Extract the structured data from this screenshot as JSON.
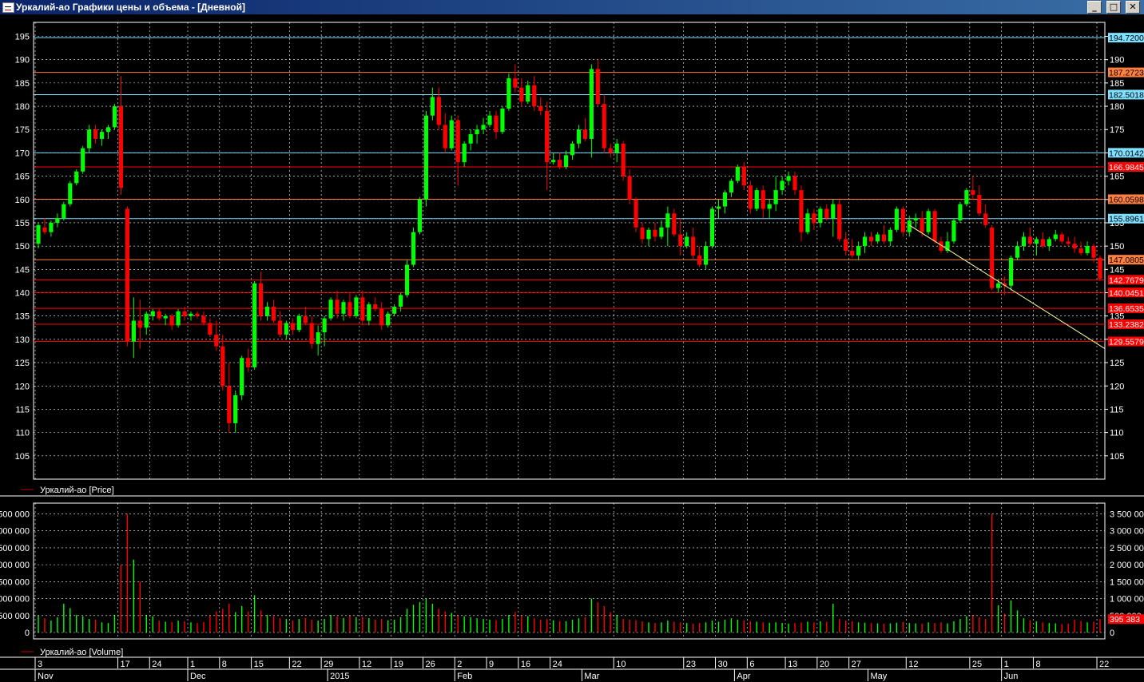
{
  "window": {
    "title": "Уркалий-ао Графики цены и объема - [Дневной]",
    "buttons": {
      "minimize": "_",
      "maximize": "□",
      "close": "✕"
    }
  },
  "colors": {
    "up": "#00ff00",
    "down": "#ff0000",
    "grid": "#ffffff",
    "axis_text": "#ffffff",
    "trendline": "#ffff99"
  },
  "legend": {
    "price": "Уркалий-ао [Price]",
    "volume": "Уркалий-ао [Volume]"
  },
  "chart_data": {
    "type": "candlestick",
    "price_axis": {
      "min": 100,
      "max": 198,
      "ticks": [
        105,
        110,
        115,
        120,
        125,
        130,
        135,
        140,
        145,
        150,
        155,
        160,
        165,
        170,
        175,
        180,
        185,
        190,
        195
      ]
    },
    "volume_axis": {
      "min": 0,
      "max": 3700000,
      "ticks": [
        0,
        500000,
        1000000,
        1500000,
        2000000,
        2500000,
        3000000,
        3500000
      ],
      "left_labels": [
        "0",
        "500 000",
        "000 000",
        "500 000",
        "000 000",
        "500 000",
        "000 000",
        "500 000"
      ],
      "right_labels": [
        "0",
        "500 000",
        "1 000 000",
        "1 500 000",
        "2 000 000",
        "2 500 000",
        "3 000 000",
        "3 500 000"
      ]
    },
    "levels": [
      {
        "value": 194.72,
        "label": "194.7200",
        "color": "#7fe0ff",
        "text": "#000000"
      },
      {
        "value": 187.272,
        "label": "187.2723",
        "color": "#ff8040",
        "text": "#000000"
      },
      {
        "value": 182.5018,
        "label": "182.5018",
        "color": "#7fe0ff",
        "text": "#000000"
      },
      {
        "value": 170.0142,
        "label": "170.0142",
        "color": "#7fe0ff",
        "text": "#000000"
      },
      {
        "value": 166.984,
        "label": "166.9845",
        "color": "#ff0000",
        "text": "#ffffff"
      },
      {
        "value": 160.059,
        "label": "160.0598",
        "color": "#ff8040",
        "text": "#000000"
      },
      {
        "value": 155.896,
        "label": "155.8961",
        "color": "#7fe0ff",
        "text": "#000000"
      },
      {
        "value": 147.08,
        "label": "147.0805",
        "color": "#ff8040",
        "text": "#000000"
      },
      {
        "value": 142.767,
        "label": "142.7679",
        "color": "#ff0000",
        "text": "#ffffff"
      },
      {
        "value": 140.045,
        "label": "140.0451",
        "color": "#ff0000",
        "text": "#ffffff"
      },
      {
        "value": 136.653,
        "label": "136.6535",
        "color": "#ff0000",
        "text": "#ffffff"
      },
      {
        "value": 133.238,
        "label": "133.2382",
        "color": "#ff0000",
        "text": "#ffffff"
      },
      {
        "value": 129.557,
        "label": "129.5579",
        "color": "#ff0000",
        "text": "#ffffff"
      }
    ],
    "last_volume_label": "395 383",
    "last_volume": 395383,
    "trendline": {
      "from": {
        "bar": 137,
        "price": 154.5
      },
      "to": {
        "bar": 194,
        "price": 128
      }
    },
    "day_labels": [
      {
        "bar": 0,
        "label": "3"
      },
      {
        "bar": 13,
        "label": "17"
      },
      {
        "bar": 18,
        "label": "24"
      },
      {
        "bar": 24,
        "label": "1"
      },
      {
        "bar": 29,
        "label": "8"
      },
      {
        "bar": 34,
        "label": "15"
      },
      {
        "bar": 40,
        "label": "22"
      },
      {
        "bar": 45,
        "label": "29"
      },
      {
        "bar": 51,
        "label": "12"
      },
      {
        "bar": 56,
        "label": "19"
      },
      {
        "bar": 61,
        "label": "26"
      },
      {
        "bar": 66,
        "label": "2"
      },
      {
        "bar": 71,
        "label": "9"
      },
      {
        "bar": 76,
        "label": "16"
      },
      {
        "bar": 81,
        "label": "24"
      },
      {
        "bar": 91,
        "label": "10"
      },
      {
        "bar": 102,
        "label": "23"
      },
      {
        "bar": 107,
        "label": "30"
      },
      {
        "bar": 112,
        "label": "6"
      },
      {
        "bar": 118,
        "label": "13"
      },
      {
        "bar": 123,
        "label": "20"
      },
      {
        "bar": 128,
        "label": "27"
      },
      {
        "bar": 137,
        "label": "12"
      },
      {
        "bar": 147,
        "label": "25"
      },
      {
        "bar": 152,
        "label": "1"
      },
      {
        "bar": 157,
        "label": "8"
      },
      {
        "bar": 167,
        "label": "22"
      }
    ],
    "month_labels": [
      {
        "bar": 0,
        "label": "Nov"
      },
      {
        "bar": 24,
        "label": "Dec"
      },
      {
        "bar": 46,
        "label": "2015"
      },
      {
        "bar": 66,
        "label": "Feb"
      },
      {
        "bar": 86,
        "label": "Mar"
      },
      {
        "bar": 110,
        "label": "Apr"
      },
      {
        "bar": 131,
        "label": "May"
      },
      {
        "bar": 152,
        "label": "Jun"
      }
    ],
    "candles": [
      [
        150.5,
        155,
        149.5,
        154.5,
        500000
      ],
      [
        154,
        156,
        152.5,
        153,
        420000
      ],
      [
        153,
        155.5,
        152,
        155,
        350000
      ],
      [
        155,
        157,
        154,
        156,
        450000
      ],
      [
        156,
        159.5,
        155.5,
        159,
        850000
      ],
      [
        159,
        164,
        158.5,
        163.5,
        720000
      ],
      [
        163.5,
        166.5,
        163,
        166,
        520000
      ],
      [
        166,
        171.5,
        165.5,
        171,
        480000
      ],
      [
        171,
        176,
        170,
        175,
        400000
      ],
      [
        175,
        176,
        172,
        173,
        380000
      ],
      [
        173,
        175,
        171.5,
        174.5,
        300000
      ],
      [
        174.5,
        176,
        173,
        175.5,
        280000
      ],
      [
        175.5,
        180.5,
        175,
        180,
        520000
      ],
      [
        180,
        186.5,
        161,
        162.5,
        2000000
      ],
      [
        158,
        158.5,
        128.5,
        129.5,
        3500000
      ],
      [
        129.5,
        139,
        126,
        134,
        2150000
      ],
      [
        134,
        138.5,
        128,
        132.5,
        1500000
      ],
      [
        132.5,
        136,
        131,
        135.5,
        520000
      ],
      [
        135,
        136.5,
        134,
        136,
        480000
      ],
      [
        136,
        136.5,
        134,
        134.5,
        350000
      ],
      [
        134.5,
        135.5,
        133,
        135,
        320000
      ],
      [
        135,
        135.5,
        132,
        133,
        310000
      ],
      [
        133,
        136.5,
        132.5,
        136,
        350000
      ],
      [
        136,
        137,
        134,
        135,
        330000
      ],
      [
        135,
        136,
        134,
        135.5,
        300000
      ],
      [
        135.5,
        136,
        134.5,
        135,
        280000
      ],
      [
        135,
        136,
        133,
        133.5,
        310000
      ],
      [
        133.5,
        134.5,
        130.5,
        131,
        500000
      ],
      [
        131,
        134,
        127.5,
        128.5,
        620000
      ],
      [
        128.5,
        131,
        119,
        120,
        700000
      ],
      [
        120,
        125,
        110,
        112,
        850000
      ],
      [
        112,
        119,
        110,
        118,
        600000
      ],
      [
        118,
        126.5,
        117,
        126,
        780000
      ],
      [
        126,
        128,
        123,
        124,
        620000
      ],
      [
        124,
        142.5,
        123.5,
        142,
        1100000
      ],
      [
        142,
        144.5,
        134,
        135,
        650000
      ],
      [
        135,
        138,
        134,
        137,
        520000
      ],
      [
        137,
        138.5,
        133.5,
        134,
        480000
      ],
      [
        134,
        136,
        130.5,
        131,
        420000
      ],
      [
        131,
        134,
        130,
        133.5,
        400000
      ],
      [
        133.5,
        134.5,
        131,
        132,
        350000
      ],
      [
        132,
        135.5,
        131.5,
        135,
        400000
      ],
      [
        135,
        137,
        133,
        133.5,
        430000
      ],
      [
        133.5,
        135,
        128,
        129,
        380000
      ],
      [
        129,
        133,
        126.5,
        131.5,
        350000
      ],
      [
        131.5,
        135,
        128.5,
        134.5,
        400000
      ],
      [
        134.5,
        139,
        134,
        138.5,
        520000
      ],
      [
        138.5,
        140.5,
        134.5,
        135.5,
        480000
      ],
      [
        135.5,
        138.5,
        134,
        138,
        430000
      ],
      [
        138,
        140,
        134.5,
        135,
        500000
      ],
      [
        135,
        139.5,
        134.5,
        139,
        450000
      ],
      [
        139,
        140.5,
        133,
        134,
        460000
      ],
      [
        134,
        138,
        133,
        137.5,
        420000
      ],
      [
        137.5,
        139,
        136,
        136.5,
        380000
      ],
      [
        136.5,
        138,
        132,
        133,
        400000
      ],
      [
        133,
        136,
        132.5,
        135.5,
        360000
      ],
      [
        135.5,
        137.5,
        135,
        137,
        380000
      ],
      [
        137,
        140,
        136,
        139.5,
        450000
      ],
      [
        139.5,
        147,
        139,
        146,
        700000
      ],
      [
        146,
        154,
        145.5,
        153,
        820000
      ],
      [
        153,
        160.5,
        152.5,
        160,
        900000
      ],
      [
        160,
        179,
        158.5,
        178,
        1000000
      ],
      [
        178,
        184,
        177,
        182,
        850000
      ],
      [
        182,
        184,
        175,
        176,
        700000
      ],
      [
        176,
        178.5,
        170,
        171,
        620000
      ],
      [
        171,
        178,
        170.5,
        177,
        580000
      ],
      [
        177,
        178,
        163,
        168,
        520000
      ],
      [
        168,
        172.5,
        167,
        172,
        480000
      ],
      [
        172,
        175,
        170.5,
        174,
        450000
      ],
      [
        174,
        176,
        172,
        175,
        420000
      ],
      [
        175,
        177.5,
        174,
        176,
        400000
      ],
      [
        176,
        179,
        175.5,
        178,
        380000
      ],
      [
        178,
        179,
        173,
        174.5,
        360000
      ],
      [
        174.5,
        180,
        174,
        179.5,
        400000
      ],
      [
        179.5,
        187,
        179,
        186,
        520000
      ],
      [
        186,
        189,
        183,
        184,
        600000
      ],
      [
        184,
        186,
        180,
        181,
        520000
      ],
      [
        181,
        185.5,
        180.5,
        184.5,
        480000
      ],
      [
        184.5,
        186.5,
        179,
        180,
        420000
      ],
      [
        180,
        182,
        178,
        179,
        380000
      ],
      [
        179,
        181,
        162,
        168,
        400000
      ],
      [
        168,
        170,
        167.5,
        168.5,
        360000
      ],
      [
        168.5,
        170,
        166.5,
        167,
        340000
      ],
      [
        167,
        170.5,
        166.5,
        169.5,
        330000
      ],
      [
        169.5,
        172.5,
        168.5,
        172,
        380000
      ],
      [
        172,
        176,
        171,
        175,
        420000
      ],
      [
        175,
        177.5,
        172.5,
        173,
        450000
      ],
      [
        173,
        189,
        169,
        188,
        1000000
      ],
      [
        188,
        190,
        180,
        180.5,
        900000
      ],
      [
        180.5,
        182.5,
        170,
        171,
        780000
      ],
      [
        171,
        172,
        169,
        170,
        600000
      ],
      [
        170,
        173,
        168,
        172,
        520000
      ],
      [
        172,
        172.5,
        164,
        165,
        400000
      ],
      [
        165,
        166.5,
        159,
        160,
        380000
      ],
      [
        160,
        160.5,
        153,
        154,
        360000
      ],
      [
        154,
        155,
        150.5,
        151.5,
        330000
      ],
      [
        151.5,
        154,
        150,
        153.5,
        300000
      ],
      [
        153.5,
        155,
        151,
        152,
        280000
      ],
      [
        152,
        155.5,
        151.5,
        154,
        300000
      ],
      [
        154,
        158.5,
        150,
        157,
        350000
      ],
      [
        157,
        158,
        152,
        152.5,
        320000
      ],
      [
        152.5,
        156,
        148,
        150,
        300000
      ],
      [
        150,
        153,
        149.5,
        152,
        280000
      ],
      [
        152,
        154,
        147,
        148,
        260000
      ],
      [
        148,
        150,
        145.5,
        146,
        280000
      ],
      [
        146,
        151,
        145,
        150,
        300000
      ],
      [
        150,
        158.5,
        149.5,
        158,
        350000
      ],
      [
        158,
        160,
        156,
        158.5,
        320000
      ],
      [
        158.5,
        162,
        157,
        161.5,
        380000
      ],
      [
        161.5,
        164.5,
        160.5,
        164,
        420000
      ],
      [
        164,
        167.5,
        163.5,
        167,
        380000
      ],
      [
        167,
        168,
        162,
        163,
        360000
      ],
      [
        163,
        164,
        157,
        158,
        330000
      ],
      [
        158,
        162.5,
        157.5,
        162,
        320000
      ],
      [
        162,
        163,
        156,
        158,
        300000
      ],
      [
        158,
        160,
        156,
        159,
        290000
      ],
      [
        159,
        165,
        157.5,
        162,
        300000
      ],
      [
        162,
        165,
        161,
        164,
        280000
      ],
      [
        164,
        166,
        163,
        165,
        260000
      ],
      [
        165,
        166,
        161,
        162,
        280000
      ],
      [
        162,
        163,
        151,
        153,
        300000
      ],
      [
        153,
        158,
        152.5,
        157,
        320000
      ],
      [
        157,
        158,
        153.5,
        155,
        300000
      ],
      [
        155,
        158.5,
        154,
        158,
        330000
      ],
      [
        158,
        159,
        155.5,
        156,
        320000
      ],
      [
        156,
        160,
        152,
        159,
        850000
      ],
      [
        159,
        160,
        151,
        151.5,
        400000
      ],
      [
        151.5,
        153,
        148,
        149,
        350000
      ],
      [
        149,
        151.5,
        147.5,
        148,
        330000
      ],
      [
        148,
        151,
        147,
        150,
        300000
      ],
      [
        150,
        153,
        148.5,
        152,
        290000
      ],
      [
        152,
        153,
        150,
        151,
        280000
      ],
      [
        151,
        153,
        150.5,
        152.5,
        270000
      ],
      [
        152.5,
        154.5,
        150.5,
        151,
        260000
      ],
      [
        151,
        154,
        150,
        153.5,
        270000
      ],
      [
        153.5,
        158.5,
        153,
        158,
        290000
      ],
      [
        158,
        158.5,
        152,
        153,
        310000
      ],
      [
        153,
        156.5,
        152,
        155.5,
        280000
      ],
      [
        155.5,
        157,
        154,
        156,
        270000
      ],
      [
        156,
        157.5,
        152,
        153,
        260000
      ],
      [
        153,
        158,
        152.5,
        157.5,
        300000
      ],
      [
        157.5,
        158,
        150.5,
        151,
        280000
      ],
      [
        151,
        152,
        148.5,
        149,
        300000
      ],
      [
        149,
        153,
        148.5,
        151,
        270000
      ],
      [
        151,
        156,
        150.5,
        155.5,
        330000
      ],
      [
        155.5,
        159.5,
        155,
        159,
        400000
      ],
      [
        159,
        162.5,
        158.5,
        162,
        480000
      ],
      [
        162,
        165,
        160,
        161,
        520000
      ],
      [
        161,
        163,
        156.5,
        157,
        450000
      ],
      [
        157,
        159,
        154,
        154.5,
        400000
      ],
      [
        154,
        154.5,
        140.5,
        141,
        3500000
      ],
      [
        141,
        143,
        140,
        142,
        800000
      ],
      [
        142,
        143.5,
        139.5,
        141.5,
        550000
      ],
      [
        141.5,
        148,
        140.5,
        147.5,
        950000
      ],
      [
        147.5,
        151,
        147,
        150,
        650000
      ],
      [
        150,
        153,
        149,
        152,
        420000
      ],
      [
        152,
        154,
        150,
        150.5,
        360000
      ],
      [
        150.5,
        152,
        148,
        151.5,
        330000
      ],
      [
        151.5,
        153,
        149.5,
        150,
        300000
      ],
      [
        150,
        152,
        149,
        151.5,
        280000
      ],
      [
        151.5,
        153.5,
        151,
        152.5,
        270000
      ],
      [
        152.5,
        153,
        150.5,
        151,
        250000
      ],
      [
        151,
        152,
        150,
        150.5,
        260000
      ],
      [
        150.5,
        152,
        148.5,
        149.5,
        380000
      ],
      [
        149.5,
        151,
        148,
        148.5,
        340000
      ],
      [
        148.5,
        151,
        148,
        150,
        300000
      ],
      [
        150,
        150.5,
        146.5,
        147.5,
        320000
      ],
      [
        147.5,
        148,
        142.5,
        143,
        395383
      ]
    ]
  }
}
